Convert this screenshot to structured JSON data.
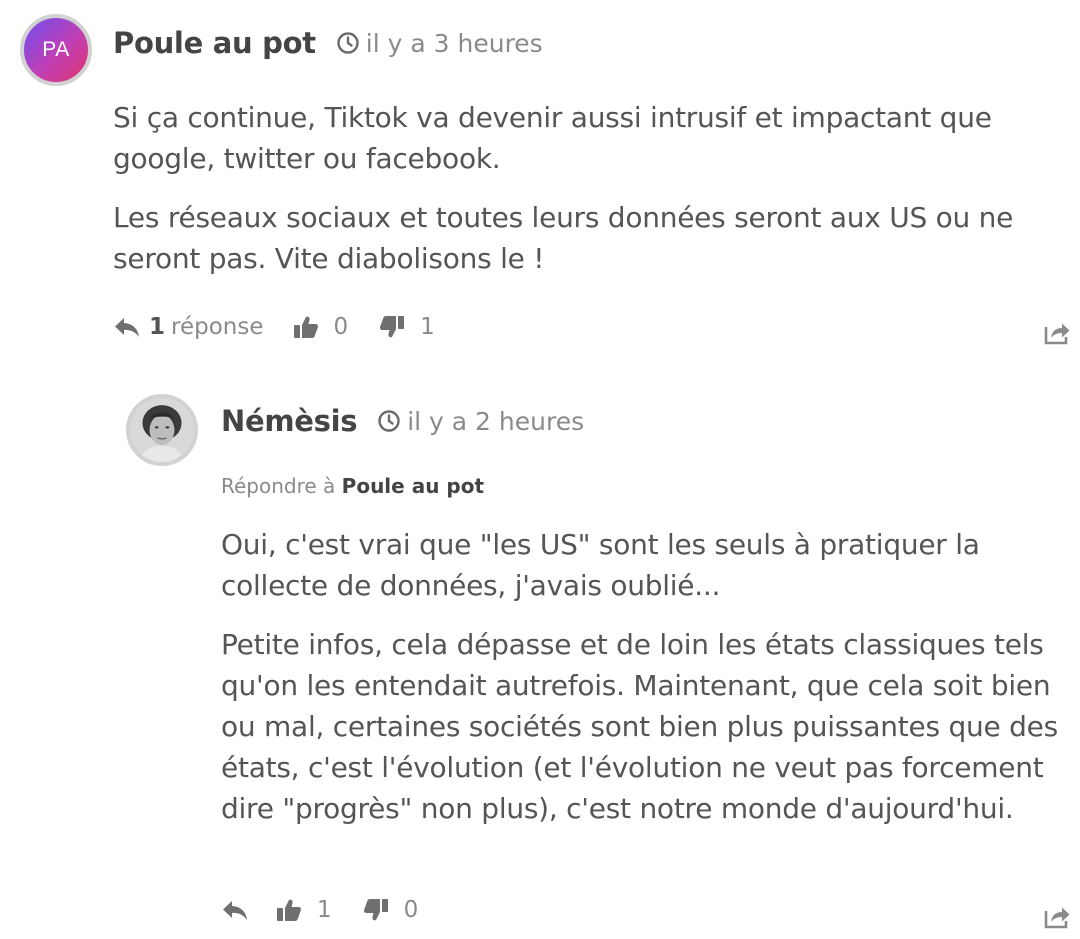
{
  "comments": [
    {
      "avatar_text": "PA",
      "author": "Poule au pot",
      "time": "il y a 3 heures",
      "paragraphs": [
        "Si ça continue, Tiktok va devenir aussi intrusif et impactant que google, twitter ou facebook.",
        "Les réseaux sociaux et toutes leurs données seront aux US ou ne seront pas. Vite diabolisons le !"
      ],
      "reply_count": "1",
      "reply_label": "réponse",
      "upvotes": "0",
      "downvotes": "1"
    },
    {
      "author": "Némèsis",
      "time": "il y a 2 heures",
      "reply_to_prefix": "Répondre à",
      "reply_to_author": "Poule au pot",
      "paragraphs": [
        "Oui, c'est vrai que \"les US\" sont les seuls à pratiquer la collecte de données, j'avais oublié...",
        "Petite infos, cela dépasse et de loin les états classiques tels qu'on les entendait autrefois. Maintenant, que cela soit bien ou mal, certaines sociétés sont bien plus puissantes que des états, c'est l'évolution (et l'évolution ne veut pas forcement dire \"progrès\" non plus), c'est notre monde d'aujourd'hui."
      ],
      "upvotes": "1",
      "downvotes": "0"
    }
  ],
  "icons": {
    "clock": "clock-icon",
    "reply": "reply-arrow-icon",
    "upvote": "thumbs-up-icon",
    "downvote": "thumbs-down-icon",
    "share": "share-icon"
  },
  "colors": {
    "avatar_gradient_start": "#6f4ff0",
    "avatar_gradient_end": "#e0336c",
    "text": "#555555",
    "muted": "#8a8a8a"
  }
}
